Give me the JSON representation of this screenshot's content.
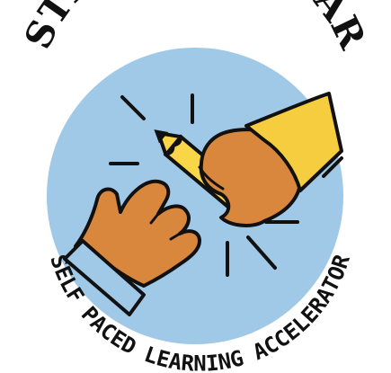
{
  "logo": {
    "title": "STRIDE SCHOLAR",
    "tagline": "SELF PACED LEARNING ACCELERATOR"
  },
  "colors": {
    "circle": "#9fc9e7",
    "skin": "#d9873c",
    "sleeve": "#f6cd3f",
    "pencil": "#f9d648",
    "outline": "#111111",
    "background": "#ffffff"
  }
}
